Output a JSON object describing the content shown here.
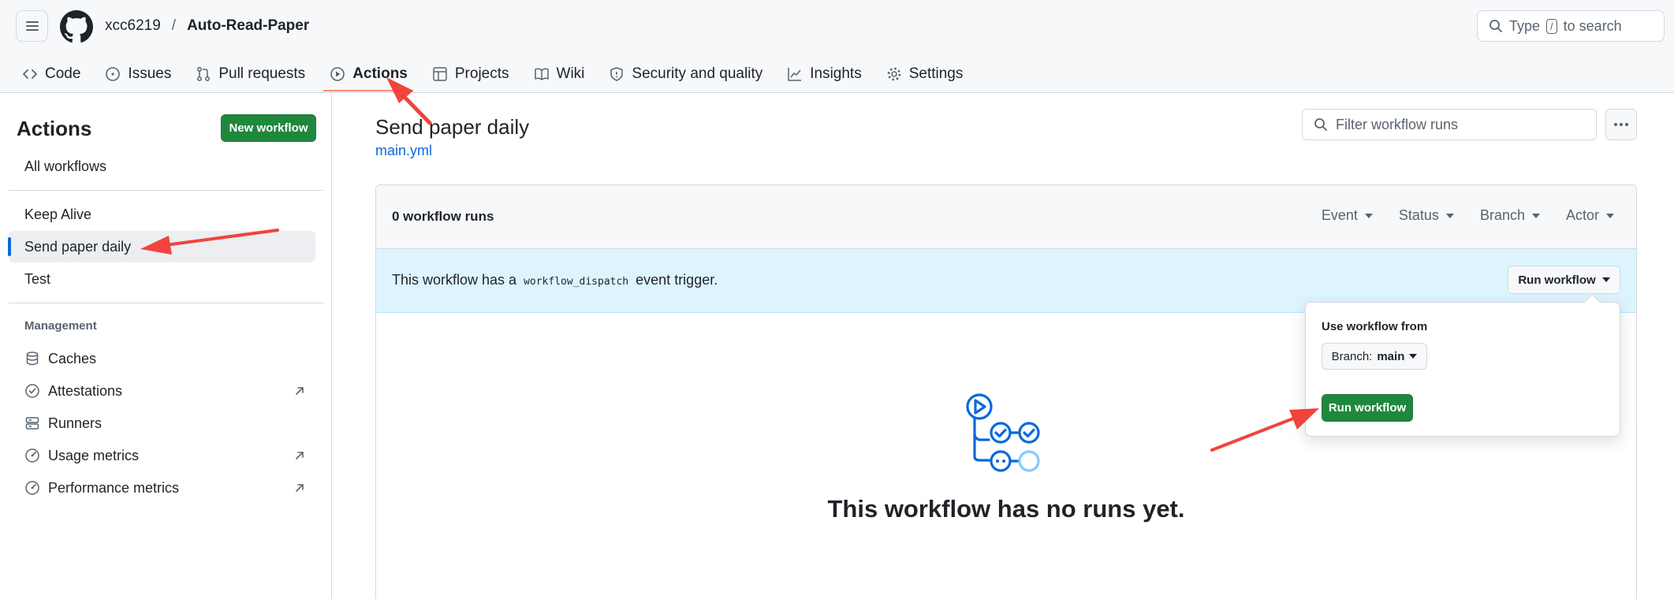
{
  "header": {
    "owner": "xcc6219",
    "separator": "/",
    "repo": "Auto-Read-Paper",
    "search": {
      "prefix": "Type",
      "key": "/",
      "suffix": "to search"
    }
  },
  "tabs": [
    {
      "label": "Code",
      "icon": "code-icon"
    },
    {
      "label": "Issues",
      "icon": "issue-icon"
    },
    {
      "label": "Pull requests",
      "icon": "pull-request-icon"
    },
    {
      "label": "Actions",
      "icon": "play-icon",
      "selected": true
    },
    {
      "label": "Projects",
      "icon": "table-icon"
    },
    {
      "label": "Wiki",
      "icon": "book-icon"
    },
    {
      "label": "Security and quality",
      "icon": "shield-icon"
    },
    {
      "label": "Insights",
      "icon": "graph-icon"
    },
    {
      "label": "Settings",
      "icon": "gear-icon"
    }
  ],
  "sidebar": {
    "title": "Actions",
    "new_workflow": "New workflow",
    "all_workflows": "All workflows",
    "workflows": [
      "Keep Alive",
      "Send paper daily",
      "Test"
    ],
    "active_workflow": "Send paper daily",
    "management_heading": "Management",
    "management": [
      {
        "label": "Caches",
        "icon": "database-icon",
        "external": false
      },
      {
        "label": "Attestations",
        "icon": "verified-icon",
        "external": true
      },
      {
        "label": "Runners",
        "icon": "server-icon",
        "external": false
      },
      {
        "label": "Usage metrics",
        "icon": "meter-icon",
        "external": true
      },
      {
        "label": "Performance metrics",
        "icon": "meter-icon",
        "external": true
      }
    ]
  },
  "main": {
    "title": "Send paper daily",
    "file": "main.yml",
    "filter_placeholder": "Filter workflow runs",
    "runs_count": "0 workflow runs",
    "filters": [
      "Event",
      "Status",
      "Branch",
      "Actor"
    ],
    "dispatch_before": "This workflow has a",
    "dispatch_code": "workflow_dispatch",
    "dispatch_after": "event trigger.",
    "run_workflow": "Run workflow",
    "empty_text": "This workflow has no runs yet."
  },
  "dropdown": {
    "title": "Use workflow from",
    "branch_label": "Branch:",
    "branch_value": "main",
    "run_button": "Run workflow"
  },
  "colors": {
    "accent": "#0969da",
    "green": "#1f883d",
    "tab_underline": "#fd8c73",
    "banner": "#ddf4ff",
    "annotation": "#f0443c"
  }
}
